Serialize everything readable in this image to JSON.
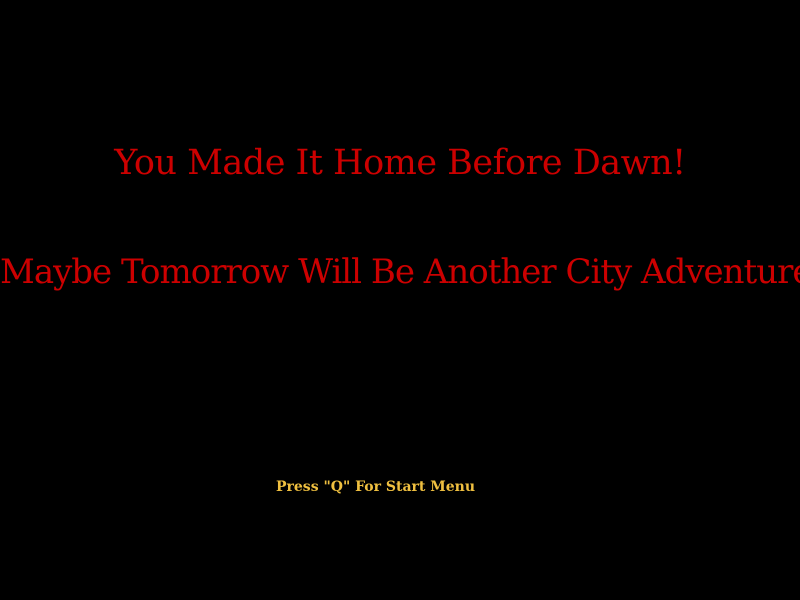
{
  "screen": {
    "title_line": "You Made It Home Before Dawn!",
    "subtitle_line": "Maybe Tomorrow Will Be Another City Adventure",
    "prompt": "Press \"Q\" For Start Menu"
  },
  "colors": {
    "background": "#000000",
    "headline": "#cc0000",
    "prompt": "#f0c040"
  }
}
